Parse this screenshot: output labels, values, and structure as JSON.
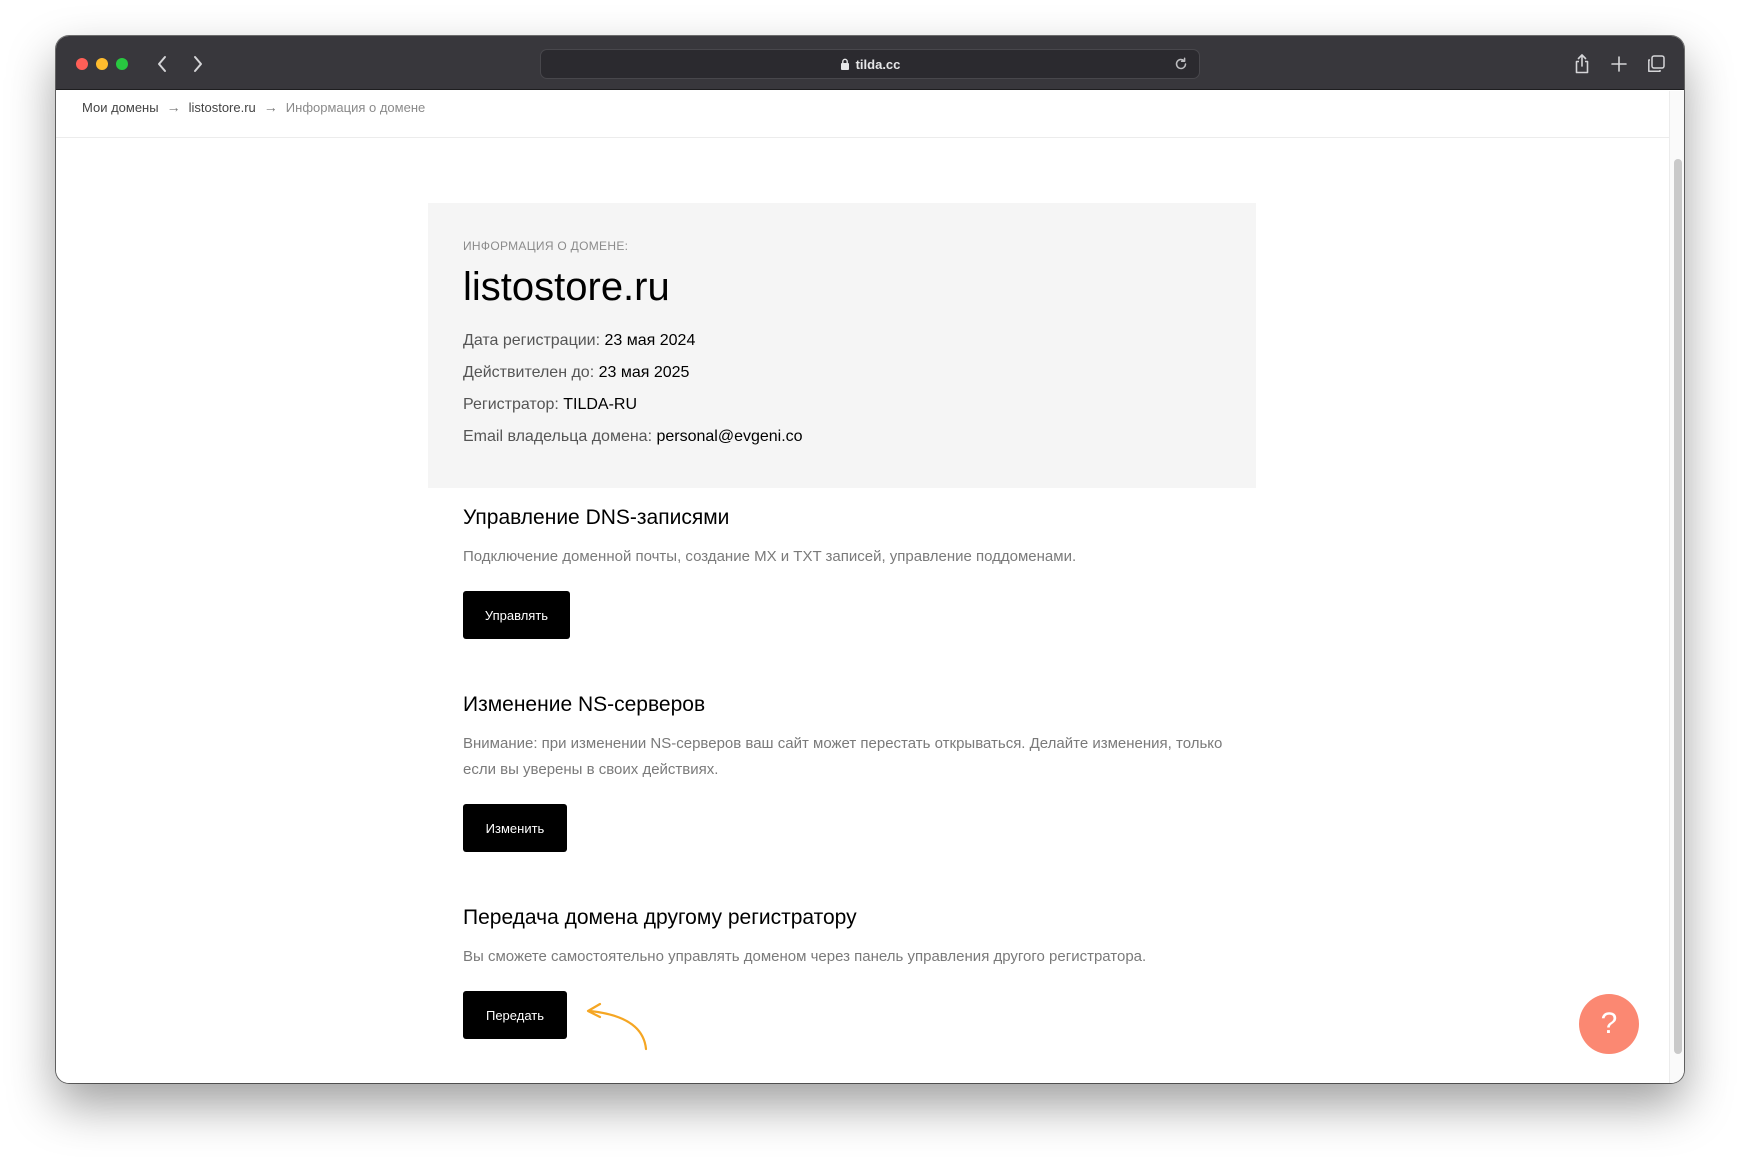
{
  "browser": {
    "url": "tilda.cc"
  },
  "breadcrumb": {
    "items": [
      "Мои домены",
      "listostore.ru",
      "Информация о домене"
    ],
    "separator": "→"
  },
  "domain_info": {
    "kicker": "ИНФОРМАЦИЯ О ДОМЕНЕ:",
    "domain": "listostore.ru",
    "rows": [
      {
        "label": "Дата регистрации: ",
        "value": "23 мая 2024"
      },
      {
        "label": "Действителен до: ",
        "value": "23 мая 2025"
      },
      {
        "label": "Регистратор: ",
        "value": "TILDA-RU"
      },
      {
        "label": "Email владельца домена: ",
        "value": "personal@evgeni.co"
      }
    ]
  },
  "sections": [
    {
      "title": "Управление DNS-записями",
      "description": "Подключение доменной почты, создание MX и TXT записей, управление поддоменами.",
      "button": "Управлять"
    },
    {
      "title": "Изменение NS-серверов",
      "description": "Внимание: при изменении NS-серверов ваш сайт может перестать открываться. Делайте изменения, только если вы уверены в своих действиях.",
      "button": "Изменить"
    },
    {
      "title": "Передача домена другому регистратору",
      "description": "Вы сможете самостоятельно управлять доменом через панель управления другого регистратора.",
      "button": "Передать"
    }
  ],
  "help": {
    "icon": "question-mark-icon",
    "symbol": "?"
  },
  "colors": {
    "titlebar": "#38373c",
    "button": "#000000",
    "help_button": "#fb8872",
    "annotation_arrow": "#f5a623",
    "card_bg": "#f5f5f5"
  }
}
